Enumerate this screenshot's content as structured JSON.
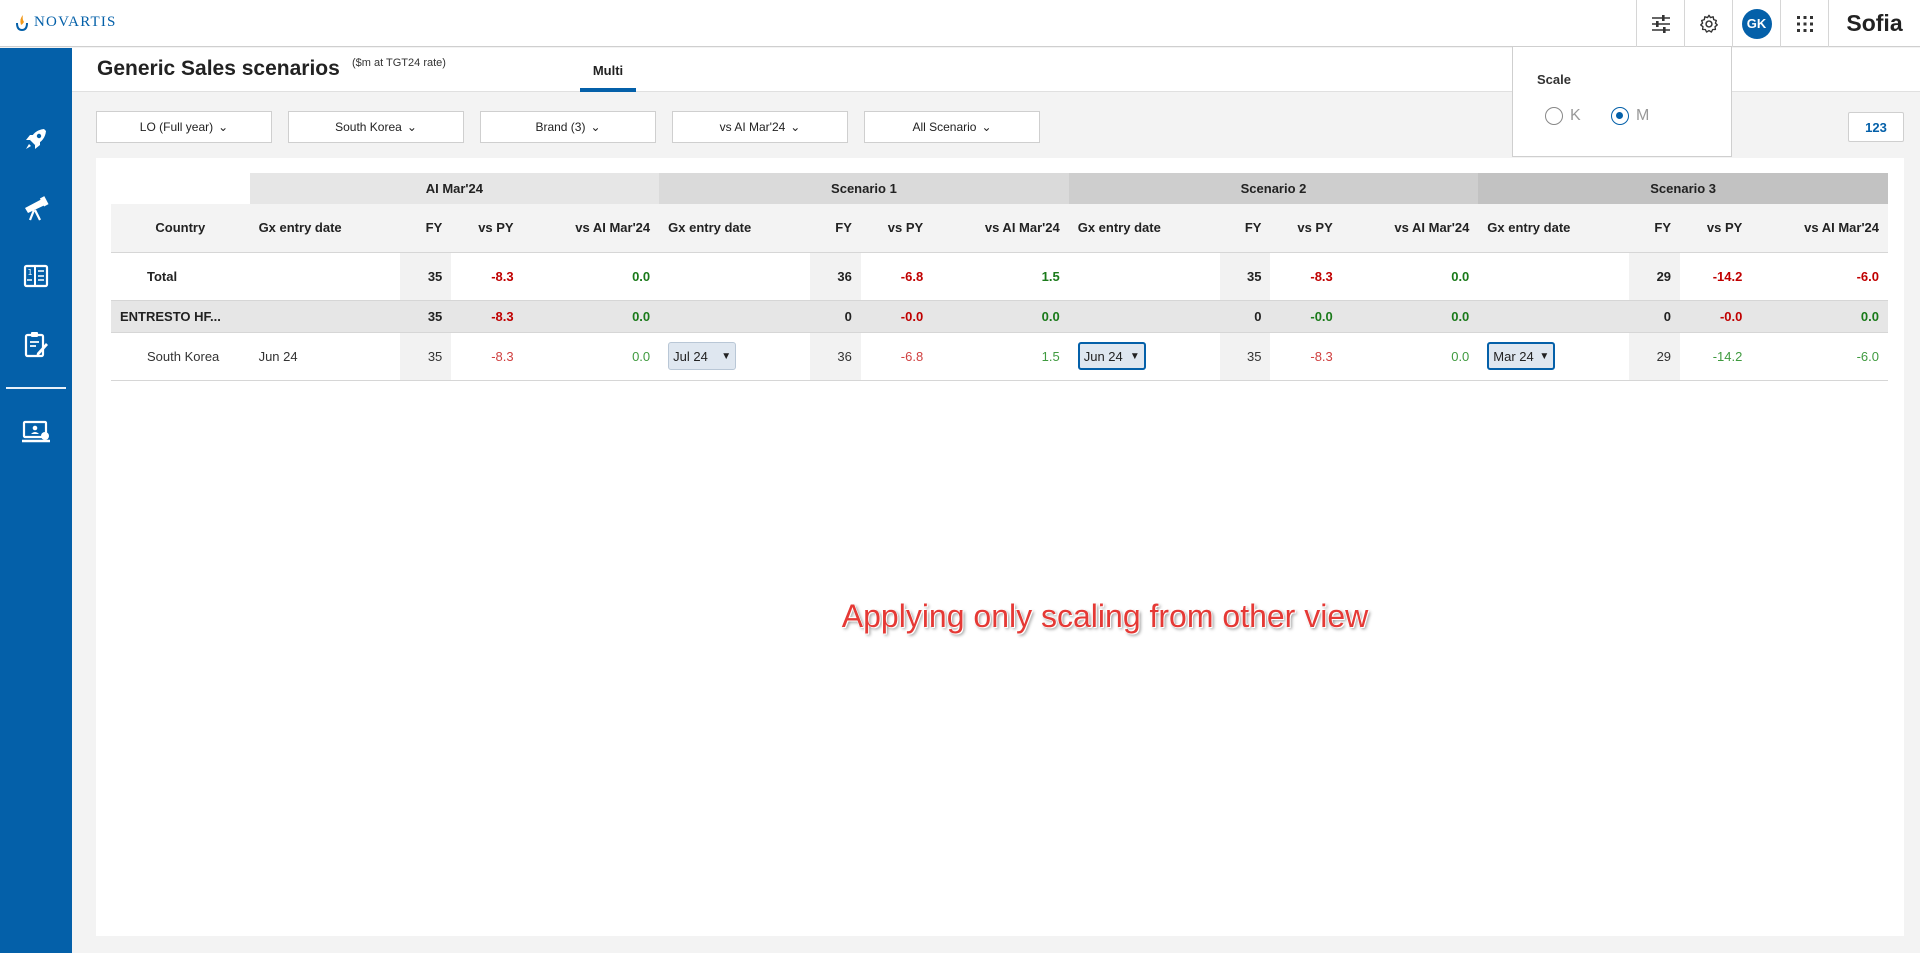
{
  "brand": {
    "logo_text": "NOVARTIS",
    "app_name": "Sofia",
    "user_initials": "GK"
  },
  "header": {
    "title": "Generic Sales scenarios",
    "subtitle": "($m at TGT24 rate)",
    "tab": "Multi"
  },
  "filters": [
    "LO (Full year)",
    "South Korea",
    "Brand (3)",
    "vs AI Mar'24",
    "All Scenario"
  ],
  "number_toggle": "123",
  "scale": {
    "title": "Scale",
    "options": [
      "K",
      "M"
    ],
    "selected": "M"
  },
  "table": {
    "groups": [
      "AI Mar'24",
      "Scenario 1",
      "Scenario 2",
      "Scenario 3"
    ],
    "country_header": "Country",
    "columns": [
      "Gx entry date",
      "FY",
      "vs PY",
      "vs AI Mar'24"
    ],
    "rows": [
      {
        "label": "Total",
        "cells": [
          {
            "date": "",
            "fy": "35",
            "vspy": "-8.3",
            "vsai": "0.0"
          },
          {
            "date": "",
            "fy": "36",
            "vspy": "-6.8",
            "vsai": "1.5"
          },
          {
            "date": "",
            "fy": "35",
            "vspy": "-8.3",
            "vsai": "0.0"
          },
          {
            "date": "",
            "fy": "29",
            "vspy": "-14.2",
            "vsai": "-6.0"
          }
        ]
      },
      {
        "label": "ENTRESTO HF...",
        "cells": [
          {
            "date": "",
            "fy": "35",
            "vspy": "-8.3",
            "vsai": "0.0"
          },
          {
            "date": "",
            "fy": "0",
            "vspy": "-0.0",
            "vsai": "0.0"
          },
          {
            "date": "",
            "fy": "0",
            "vspy": "-0.0",
            "vsai": "0.0"
          },
          {
            "date": "",
            "fy": "0",
            "vspy": "-0.0",
            "vsai": "0.0"
          }
        ]
      },
      {
        "label": "South Korea",
        "cells": [
          {
            "date": "Jun 24",
            "fy": "35",
            "vspy": "-8.3",
            "vsai": "0.0"
          },
          {
            "date": "Jul 24",
            "fy": "36",
            "vspy": "-6.8",
            "vsai": "1.5"
          },
          {
            "date": "Jun 24",
            "fy": "35",
            "vspy": "-8.3",
            "vsai": "0.0"
          },
          {
            "date": "Mar 24",
            "fy": "29",
            "vspy": "-14.2",
            "vsai": "-6.0"
          }
        ]
      }
    ]
  },
  "annotation": "Applying only scaling from other view"
}
